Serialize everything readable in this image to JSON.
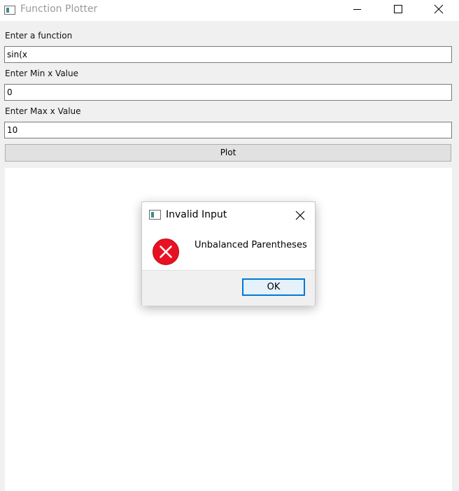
{
  "window": {
    "title": "Function Plotter",
    "icon": "app-window-icon"
  },
  "titlebar_buttons": {
    "minimize_icon": "minimize-icon",
    "maximize_icon": "maximize-icon",
    "close_icon": "close-icon"
  },
  "form": {
    "function_label": "Enter a function",
    "function_value": "sin(x",
    "min_label": "Enter Min x Value",
    "min_value": "0",
    "max_label": "Enter Max x Value",
    "max_value": "10",
    "plot_button": "Plot"
  },
  "dialog": {
    "title": "Invalid Input",
    "icon": "app-window-icon",
    "close_icon": "close-icon",
    "error_icon": "error-icon",
    "message": "Unbalanced Parentheses",
    "ok_button": "OK"
  },
  "colors": {
    "window_background": "#f0f0f0",
    "error_red": "#e81123",
    "ok_focus_border": "#0078d7",
    "app_icon_teal": "#3e8f86"
  }
}
